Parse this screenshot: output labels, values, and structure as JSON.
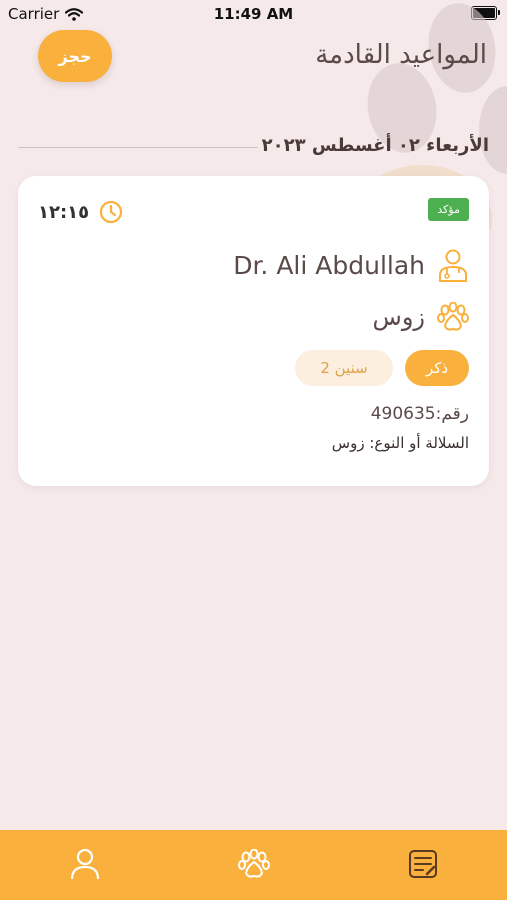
{
  "status_bar": {
    "carrier": "Carrier",
    "time": "11:49 AM"
  },
  "header": {
    "title": "المواعيد القادمة",
    "book_button": "حجز"
  },
  "date_label": "الأربعاء ٠٢ أغسطس ٢٠٢٣",
  "appointment": {
    "time": "١٢:١٥",
    "status": "مؤكد",
    "doctor": "Dr. Ali Abdullah",
    "pet_name": "زوس",
    "gender_tag": "ذكر",
    "age_tag": "2 سنين",
    "number_line": "رقم:490635",
    "breed_line": "السلالة أو النوع: زوس"
  },
  "colors": {
    "accent": "#f9b03c",
    "status_green": "#4caf50",
    "background": "#f6e9ea"
  },
  "tabbar_icons": [
    "profile-icon",
    "paw-icon",
    "appointments-icon"
  ]
}
